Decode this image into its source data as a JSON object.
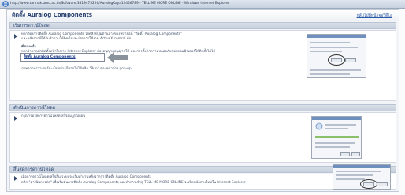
{
  "browser": {
    "title": "http://www.tarmak.umu.ac.th/Software.3819475226/AuralogKaya12456789 - TELL ME MORE ONLINE - Windows Internet Explorer"
  },
  "page": {
    "title": "ติดตั้ง Auralog Components",
    "close_link": "กลับไปที่หน้าจอวิดีโอ"
  },
  "sections": [
    {
      "header": "เริ่มการดาวน์โหลด",
      "lines": [
        "หากต้องการติดตั้ง Auralog Components ให้คลิกที่ปุ่มด้านล่างของหน้าจอนี้ \"ติดตั้ง Auralog Components\"",
        "และหลังจากที่ได้รับคำถามให้ติดตั้งและเปิดการใช้งาน ActiveX control ต่อ"
      ],
      "note_label": "คำแนะนำ",
      "note_text": "หากว่าขาดตัวติดตั้งหน้าไปจาก Internet Explorer ต้องอนุญาตอนุญาตให้ และการตั้งค่าความปลอดภัยของคอมพิวเตอร์ให้ติดตั้งไม่ได้",
      "install_link": "ติดตั้ง Auralog Components",
      "footer": "ภาพจากบราวเซอร์จะเป็นอย่างนี้หากไม่ได้คลิก \"Run\" ของหน้าต่าง pop-up"
    },
    {
      "header": "ดำเนินการดาวน์โหลด",
      "lines": [
        "กรุณารอให้การดาวน์โหลดเสร็จสมบูรณ์ก่อน"
      ]
    },
    {
      "header": "สิ้นสุดการดาวน์โหลด",
      "lines": [
        "เมื่อการดาวน์โหลดเสร็จสิ้น ระบบจะเริ่มทำงานหลังจากการติดตั้ง Auralog Components",
        "คลิก \"ดำเนินการต่อ\" เพื่อเริ่มต้นการติดตั้ง Auralog Components และทำการเข้าสู่ TELL ME MORE ONLINE จะเปิดหน้าต่างใหม่ใน Internet Explorer"
      ]
    }
  ],
  "colors": {
    "accent": "#1f3a6b",
    "section_bg": "#c9d2df",
    "link": "#1e3e8a"
  }
}
